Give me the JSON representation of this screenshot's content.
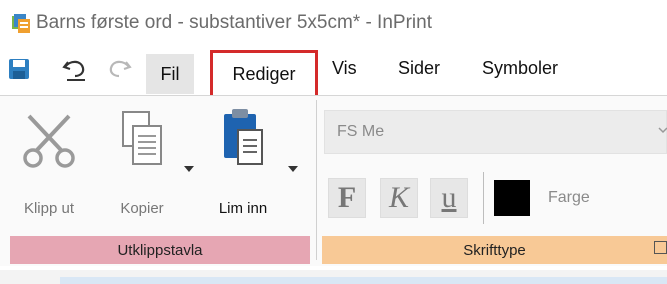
{
  "window": {
    "title": "Barns første ord - substantiver 5x5cm* - InPrint"
  },
  "quick_access": [
    {
      "name": "save-icon"
    },
    {
      "name": "undo-icon"
    },
    {
      "name": "redo-icon"
    }
  ],
  "tabs": {
    "fil": "Fil",
    "rediger": "Rediger",
    "vis": "Vis",
    "sider": "Sider",
    "symboler": "Symboler",
    "active": "Rediger"
  },
  "clipboard_group": {
    "label": "Utklippstavla",
    "color": "#e6a6b3",
    "cut": {
      "label": "Klipp ut",
      "icon": "scissors-icon",
      "enabled": false
    },
    "copy": {
      "label": "Kopier",
      "icon": "copy-icon",
      "enabled": false
    },
    "paste": {
      "label": "Lim inn",
      "icon": "paste-icon",
      "enabled": true
    }
  },
  "font_group": {
    "label": "Skrifttype",
    "color": "#f8c996",
    "font_name": "FS Me",
    "bold": "F",
    "italic": "K",
    "underline": "u",
    "color_label": "Farge",
    "color_value": "#000000"
  },
  "highlight_color": "#d42a2a"
}
